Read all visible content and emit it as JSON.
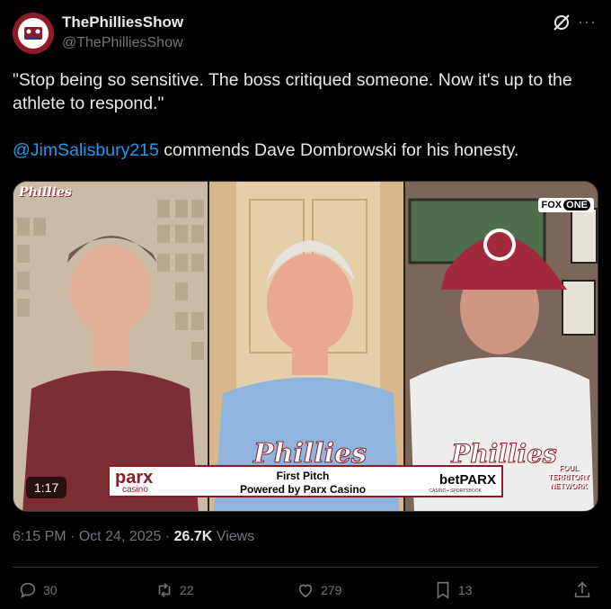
{
  "header": {
    "display_name": "ThePhilliesShow",
    "handle": "@ThePhilliesShow",
    "icons": [
      "avatar",
      "grok-icon",
      "more-icon"
    ]
  },
  "tweet": {
    "line1": "\"Stop being so sensitive. The boss critiqued someone. Now it's up to the athlete to respond.\"",
    "mention": "@JimSalisbury215",
    "line2_rest": " commends Dave Dombrowski for his honesty."
  },
  "media": {
    "duration": "1:17",
    "phillies_logo": "Phillies",
    "fox_logo": "FOX",
    "fox_logo_one": "ONE",
    "sponsor": {
      "left_brand": "parx",
      "left_sub": "casino",
      "line1": "First Pitch",
      "line2": "Powered by Parx Casino",
      "right_brand": "betPARX",
      "right_sub": "CASINO • SPORTSBOOK"
    },
    "foul_logo": "FOUL TERRITORY NETWORK",
    "jersey_text": "Phillies"
  },
  "meta": {
    "time": "6:15 PM",
    "sep1": " · ",
    "date": "Oct 24, 2025",
    "sep2": " · ",
    "views_count": "26.7K",
    "views_label": " Views"
  },
  "actions": {
    "replies": "30",
    "retweets": "22",
    "likes": "279",
    "bookmarks": "13"
  },
  "colors": {
    "background": "#000000",
    "text": "#e7e9ea",
    "secondary": "#71767b",
    "link": "#1d9bf0",
    "phillies_red": "#8e1c28"
  }
}
